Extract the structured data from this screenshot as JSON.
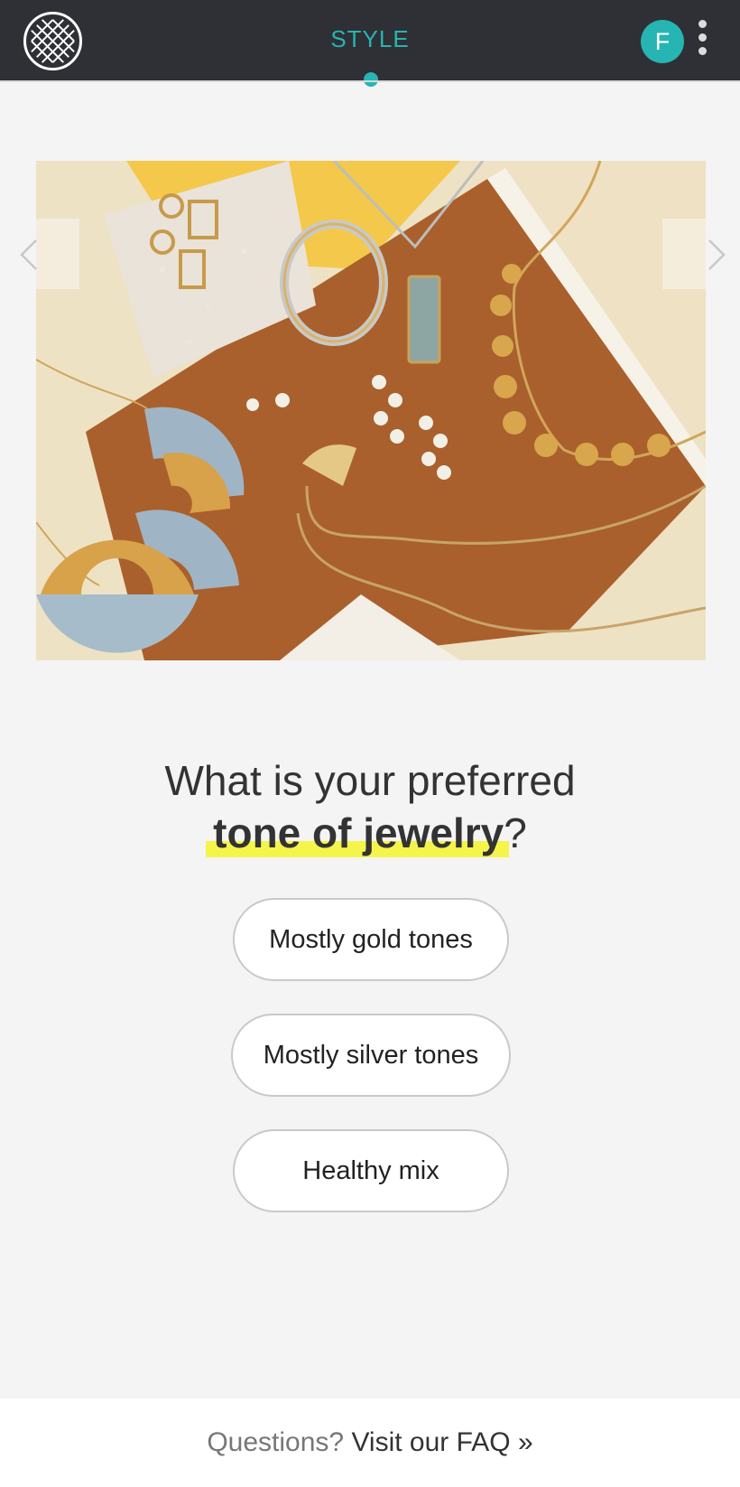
{
  "header": {
    "title": "STYLE",
    "avatar_initial": "F",
    "accent_color": "#26b5b2",
    "bar_color": "#2f3035"
  },
  "hero": {
    "carousel_prev_icon": "chevron-left-icon",
    "carousel_next_icon": "chevron-right-icon"
  },
  "question": {
    "line1": "What is your preferred",
    "highlight": "tone of jewelry",
    "suffix": "?",
    "highlight_color": "#f5f44a"
  },
  "options": [
    {
      "label": "Mostly gold tones"
    },
    {
      "label": "Mostly silver tones"
    },
    {
      "label": "Healthy mix"
    }
  ],
  "footer": {
    "prefix": "Questions?",
    "link": "Visit our FAQ »"
  }
}
